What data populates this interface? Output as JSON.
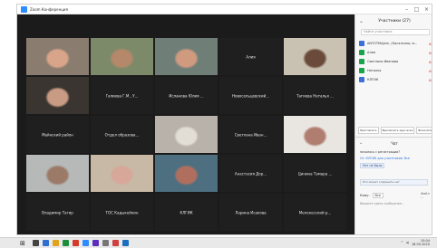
{
  "window": {
    "title": "Zoom Конференция"
  },
  "gallery": [
    {
      "name": "",
      "video": true,
      "bg": "#8a7d70",
      "fg": "#d9a58a"
    },
    {
      "name": "",
      "video": true,
      "bg": "#7d8a6a",
      "fg": "#b48868",
      "active": true
    },
    {
      "name": "",
      "video": true,
      "bg": "#6f7f78",
      "fg": "#d09a7f"
    },
    {
      "name": "Алия",
      "video": false
    },
    {
      "name": "",
      "video": true,
      "bg": "#c9c2b2",
      "fg": "#6a4a3a"
    },
    {
      "name": "",
      "video": true,
      "bg": "#3a3530",
      "fg": "#c99a84"
    },
    {
      "name": "Галиева Г.М., У...",
      "video": false
    },
    {
      "name": "Исланова Юлия ...",
      "video": false
    },
    {
      "name": "Новосельцевский...",
      "video": false
    },
    {
      "name": "Тагиева Наталья ...",
      "video": false
    },
    {
      "name": "Майнский район",
      "video": false
    },
    {
      "name": "Отдел образова...",
      "video": false
    },
    {
      "name": "",
      "video": true,
      "bg": "#b9b2aa",
      "fg": "#e3ded5"
    },
    {
      "name": "Светлана Иван...",
      "video": false
    },
    {
      "name": "",
      "video": true,
      "bg": "#e9e6e2",
      "fg": "#b07e70"
    },
    {
      "name": "",
      "video": true,
      "bg": "#b6b9b8",
      "fg": "#9b7a68"
    },
    {
      "name": "",
      "video": true,
      "bg": "#c8b9a6",
      "fg": "#d7a79a"
    },
    {
      "name": "",
      "video": true,
      "bg": "#4d6f80",
      "fg": "#b06f5e"
    },
    {
      "name": "Анастасия Дор...",
      "video": false
    },
    {
      "name": "Цинина Тамара ...",
      "video": false
    },
    {
      "name": "Владимир Тагир",
      "video": false
    },
    {
      "name": "ТОС Кадыкейкин",
      "video": false
    },
    {
      "name": "КЛГИК",
      "video": false
    },
    {
      "name": "Ларина Исакова",
      "video": false
    },
    {
      "name": "Мелекесский р...",
      "video": false
    }
  ],
  "sidebar": {
    "title": "Участники (27)",
    "search_placeholder": "Найти участника",
    "participants": [
      {
        "name": "ANTOTMAJam, (Касаткина, м...",
        "color": "#3d6fd9"
      },
      {
        "name": "Алия",
        "color": "#19a34a"
      },
      {
        "name": "Светлана Иванова",
        "color": "#19a34a"
      },
      {
        "name": "Наталья",
        "color": "#19a34a"
      },
      {
        "name": "КЛГИК",
        "color": "#3d6fd9"
      }
    ],
    "buttons": [
      "Пригласить",
      "Выключить звук всех",
      "Включить звук всех"
    ]
  },
  "chat": {
    "title": "Чат",
    "messages": [
      {
        "text": "началось с регистрации?",
        "blue": false
      },
      {
        "text": "От: КЛГИК для участников: Все",
        "blue": true
      }
    ],
    "pill": "Нет не было",
    "file_label": "Кто может сохранить чат",
    "to_label": "Кому:",
    "to_value": "Все",
    "more_label": "Файл ...",
    "input_placeholder": "Введите здесь сообщение..."
  },
  "taskbar": {
    "icons": [
      "#444444",
      "#2f6fd0",
      "#e3a21a",
      "#1d8f3b",
      "#d43a2a",
      "#2d8cff",
      "#5a2dbf",
      "#777777",
      "#d04040",
      "#1a6fc0"
    ],
    "time": "15:04",
    "date": "18.05.2020"
  }
}
